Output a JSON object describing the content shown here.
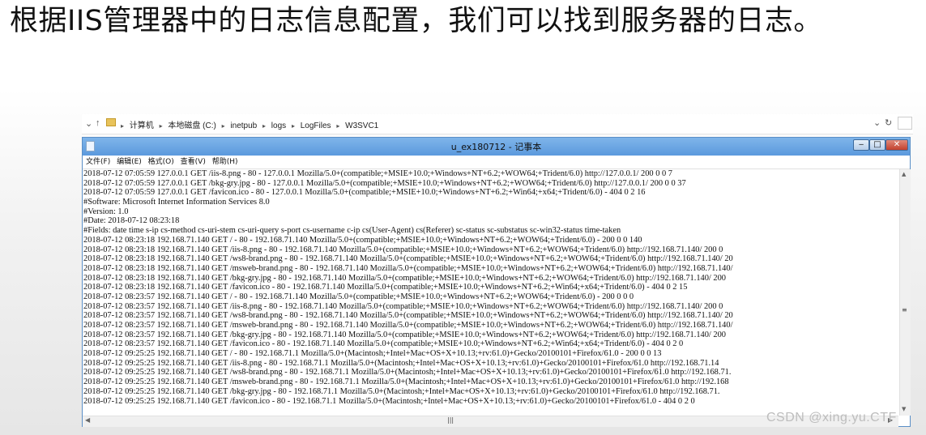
{
  "slide": {
    "heading": "根据IIS管理器中的日志信息配置，我们可以找到服务器的日志。"
  },
  "explorer": {
    "breadcrumbs": [
      "计算机",
      "本地磁盘 (C:)",
      "inetpub",
      "logs",
      "LogFiles",
      "W3SVC1"
    ]
  },
  "notepad": {
    "title": "u_ex180712 - 记事本",
    "menu": [
      "文件(F)",
      "编辑(E)",
      "格式(O)",
      "查看(V)",
      "帮助(H)"
    ],
    "lines": [
      "2018-07-12 07:05:59 127.0.0.1 GET /iis-8.png - 80 - 127.0.0.1 Mozilla/5.0+(compatible;+MSIE+10.0;+Windows+NT+6.2;+WOW64;+Trident/6.0) http://127.0.0.1/ 200 0 0 7",
      "2018-07-12 07:05:59 127.0.0.1 GET /bkg-gry.jpg - 80 - 127.0.0.1 Mozilla/5.0+(compatible;+MSIE+10.0;+Windows+NT+6.2;+WOW64;+Trident/6.0) http://127.0.0.1/ 200 0 0 37",
      "2018-07-12 07:05:59 127.0.0.1 GET /favicon.ico - 80 - 127.0.0.1 Mozilla/5.0+(compatible;+MSIE+10.0;+Windows+NT+6.2;+Win64;+x64;+Trident/6.0) - 404 0 2 16",
      "#Software: Microsoft Internet Information Services 8.0",
      "#Version: 1.0",
      "#Date: 2018-07-12 08:23:18",
      "#Fields: date time s-ip cs-method cs-uri-stem cs-uri-query s-port cs-username c-ip cs(User-Agent) cs(Referer) sc-status sc-substatus sc-win32-status time-taken",
      "2018-07-12 08:23:18 192.168.71.140 GET / - 80 - 192.168.71.140 Mozilla/5.0+(compatible;+MSIE+10.0;+Windows+NT+6.2;+WOW64;+Trident/6.0) - 200 0 0 140",
      "2018-07-12 08:23:18 192.168.71.140 GET /iis-8.png - 80 - 192.168.71.140 Mozilla/5.0+(compatible;+MSIE+10.0;+Windows+NT+6.2;+WOW64;+Trident/6.0) http://192.168.71.140/ 200 0",
      "2018-07-12 08:23:18 192.168.71.140 GET /ws8-brand.png - 80 - 192.168.71.140 Mozilla/5.0+(compatible;+MSIE+10.0;+Windows+NT+6.2;+WOW64;+Trident/6.0) http://192.168.71.140/ 20",
      "2018-07-12 08:23:18 192.168.71.140 GET /msweb-brand.png - 80 - 192.168.71.140 Mozilla/5.0+(compatible;+MSIE+10.0;+Windows+NT+6.2;+WOW64;+Trident/6.0) http://192.168.71.140/",
      "2018-07-12 08:23:18 192.168.71.140 GET /bkg-gry.jpg - 80 - 192.168.71.140 Mozilla/5.0+(compatible;+MSIE+10.0;+Windows+NT+6.2;+WOW64;+Trident/6.0) http://192.168.71.140/ 200",
      "2018-07-12 08:23:18 192.168.71.140 GET /favicon.ico - 80 - 192.168.71.140 Mozilla/5.0+(compatible;+MSIE+10.0;+Windows+NT+6.2;+Win64;+x64;+Trident/6.0) - 404 0 2 15",
      "2018-07-12 08:23:57 192.168.71.140 GET / - 80 - 192.168.71.140 Mozilla/5.0+(compatible;+MSIE+10.0;+Windows+NT+6.2;+WOW64;+Trident/6.0) - 200 0 0 0",
      "2018-07-12 08:23:57 192.168.71.140 GET /iis-8.png - 80 - 192.168.71.140 Mozilla/5.0+(compatible;+MSIE+10.0;+Windows+NT+6.2;+WOW64;+Trident/6.0) http://192.168.71.140/ 200 0",
      "2018-07-12 08:23:57 192.168.71.140 GET /ws8-brand.png - 80 - 192.168.71.140 Mozilla/5.0+(compatible;+MSIE+10.0;+Windows+NT+6.2;+WOW64;+Trident/6.0) http://192.168.71.140/ 20",
      "2018-07-12 08:23:57 192.168.71.140 GET /msweb-brand.png - 80 - 192.168.71.140 Mozilla/5.0+(compatible;+MSIE+10.0;+Windows+NT+6.2;+WOW64;+Trident/6.0) http://192.168.71.140/",
      "2018-07-12 08:23:57 192.168.71.140 GET /bkg-gry.jpg - 80 - 192.168.71.140 Mozilla/5.0+(compatible;+MSIE+10.0;+Windows+NT+6.2;+WOW64;+Trident/6.0) http://192.168.71.140/ 200",
      "2018-07-12 08:23:57 192.168.71.140 GET /favicon.ico - 80 - 192.168.71.140 Mozilla/5.0+(compatible;+MSIE+10.0;+Windows+NT+6.2;+Win64;+x64;+Trident/6.0) - 404 0 2 0",
      "2018-07-12 09:25:25 192.168.71.140 GET / - 80 - 192.168.71.1 Mozilla/5.0+(Macintosh;+Intel+Mac+OS+X+10.13;+rv:61.0)+Gecko/20100101+Firefox/61.0 - 200 0 0 13",
      "2018-07-12 09:25:25 192.168.71.140 GET /iis-8.png - 80 - 192.168.71.1 Mozilla/5.0+(Macintosh;+Intel+Mac+OS+X+10.13;+rv:61.0)+Gecko/20100101+Firefox/61.0 http://192.168.71.14",
      "2018-07-12 09:25:25 192.168.71.140 GET /ws8-brand.png - 80 - 192.168.71.1 Mozilla/5.0+(Macintosh;+Intel+Mac+OS+X+10.13;+rv:61.0)+Gecko/20100101+Firefox/61.0 http://192.168.71.",
      "2018-07-12 09:25:25 192.168.71.140 GET /msweb-brand.png - 80 - 192.168.71.1 Mozilla/5.0+(Macintosh;+Intel+Mac+OS+X+10.13;+rv:61.0)+Gecko/20100101+Firefox/61.0 http://192.168",
      "2018-07-12 09:25:25 192.168.71.140 GET /bkg-gry.jpg - 80 - 192.168.71.1 Mozilla/5.0+(Macintosh;+Intel+Mac+OS+X+10.13;+rv:61.0)+Gecko/20100101+Firefox/61.0 http://192.168.71.",
      "2018-07-12 09:25:25 192.168.71.140 GET /favicon.ico - 80 - 192.168.71.1 Mozilla/5.0+(Macintosh;+Intel+Mac+OS+X+10.13;+rv:61.0)+Gecko/20100101+Firefox/61.0 - 404 0 2 0"
    ]
  },
  "watermark": "CSDN @xing.yu.CTF",
  "colors": {
    "titlebar": "#6aa5e3",
    "close_button": "#c9483a",
    "folder_icon": "#e8c35b"
  }
}
